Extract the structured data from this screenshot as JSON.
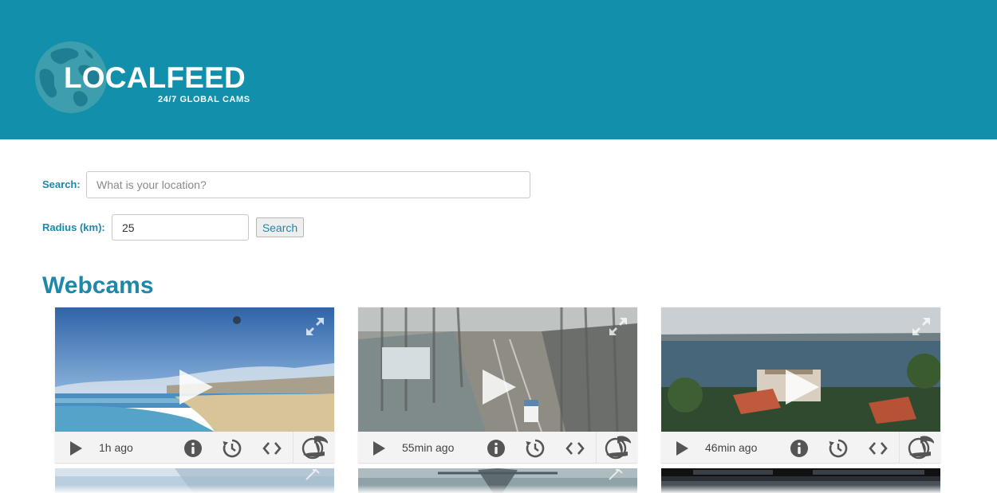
{
  "header": {
    "logo_title": "LOCALFEED",
    "logo_subtitle": "24/7 GLOBAL CAMS",
    "background_color": "#1290ab"
  },
  "search_form": {
    "search_label": "Search:",
    "search_placeholder": "What is your location?",
    "search_value": "",
    "radius_label": "Radius (km):",
    "radius_value": "25",
    "search_button_label": "Search",
    "accent_color": "#1e88a8"
  },
  "webcams": {
    "section_title": "Webcams",
    "cards": [
      {
        "updated": "1h ago",
        "scene": "beach"
      },
      {
        "updated": "55min ago",
        "scene": "bridge-road"
      },
      {
        "updated": "46min ago",
        "scene": "harbour"
      }
    ],
    "icons": [
      "play-icon",
      "info-icon",
      "replay-icon",
      "embed-code-icon",
      "brand-logo-icon",
      "expand-icon"
    ]
  }
}
